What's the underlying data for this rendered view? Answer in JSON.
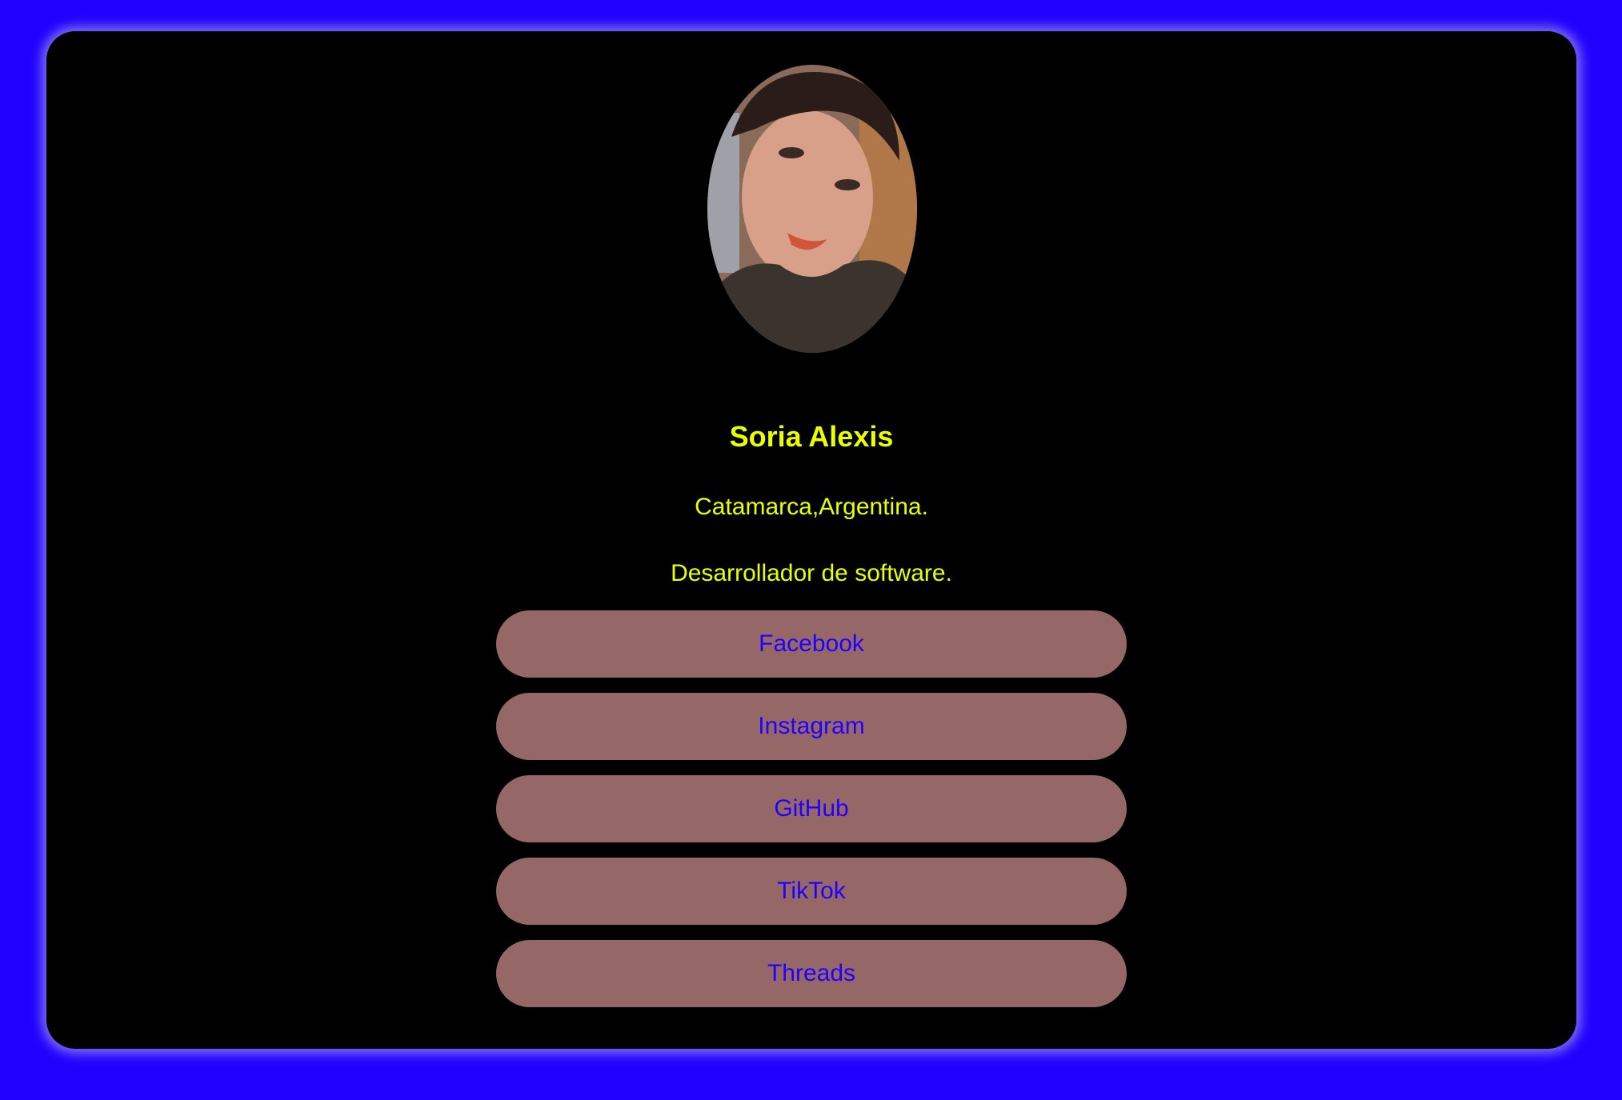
{
  "profile": {
    "name": "Soria Alexis",
    "location": "Catamarca,Argentina.",
    "role": "Desarrollador de software."
  },
  "links": [
    {
      "label": "Facebook"
    },
    {
      "label": "Instagram"
    },
    {
      "label": "GitHub"
    },
    {
      "label": "TikTok"
    },
    {
      "label": "Threads"
    }
  ],
  "colors": {
    "page_background": "#2200ff",
    "card_background": "#000000",
    "text_accent": "#eaff00",
    "button_background": "#956767",
    "button_text": "#2200ff"
  }
}
